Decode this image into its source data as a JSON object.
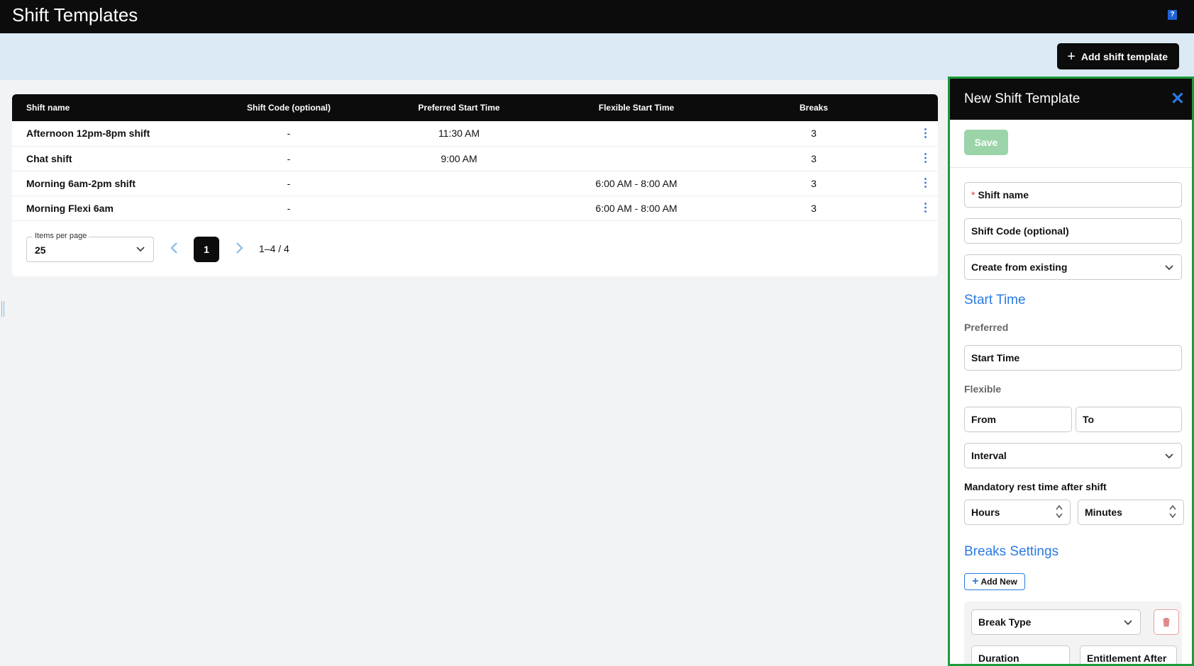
{
  "header": {
    "title": "Shift Templates",
    "help_icon": "help-icon"
  },
  "toolbar": {
    "add_label": "Add shift template"
  },
  "table": {
    "columns": [
      "Shift name",
      "Shift Code (optional)",
      "Preferred Start Time",
      "Flexible Start Time",
      "Breaks"
    ],
    "rows": [
      {
        "name": "Afternoon 12pm-8pm shift",
        "code": "-",
        "preferred": "11:30 AM",
        "flexible": "",
        "breaks": "3"
      },
      {
        "name": "Chat shift",
        "code": "-",
        "preferred": "9:00 AM",
        "flexible": "",
        "breaks": "3"
      },
      {
        "name": "Morning 6am-2pm shift",
        "code": "-",
        "preferred": "",
        "flexible": "6:00 AM - 8:00 AM",
        "breaks": "3"
      },
      {
        "name": "Morning Flexi 6am",
        "code": "-",
        "preferred": "",
        "flexible": "6:00 AM - 8:00 AM",
        "breaks": "3"
      }
    ]
  },
  "pagination": {
    "items_per_page_label": "Items per page",
    "items_per_page": "25",
    "current_page": "1",
    "range": "1–4 / 4"
  },
  "panel": {
    "title": "New Shift Template",
    "save_label": "Save",
    "shift_name_placeholder": "Shift name",
    "shift_code_placeholder": "Shift Code (optional)",
    "create_from_existing": "Create from existing",
    "start_time_section": "Start Time",
    "preferred_label": "Preferred",
    "start_time_placeholder": "Start Time",
    "flexible_label": "Flexible",
    "from_placeholder": "From",
    "to_placeholder": "To",
    "interval_placeholder": "Interval",
    "rest_label": "Mandatory rest time after shift",
    "hours_placeholder": "Hours",
    "minutes_placeholder": "Minutes",
    "breaks_section": "Breaks Settings",
    "add_new_label": "Add New",
    "break_type_placeholder": "Break Type",
    "duration_placeholder": "Duration",
    "entitlement_placeholder": "Entitlement After"
  },
  "colors": {
    "accent": "#2a7ae2",
    "header_bg": "#0c0c0c",
    "subbar_bg": "#dbeaf4",
    "save_disabled": "#9bd4a8",
    "panel_border": "#1e9a3a"
  }
}
